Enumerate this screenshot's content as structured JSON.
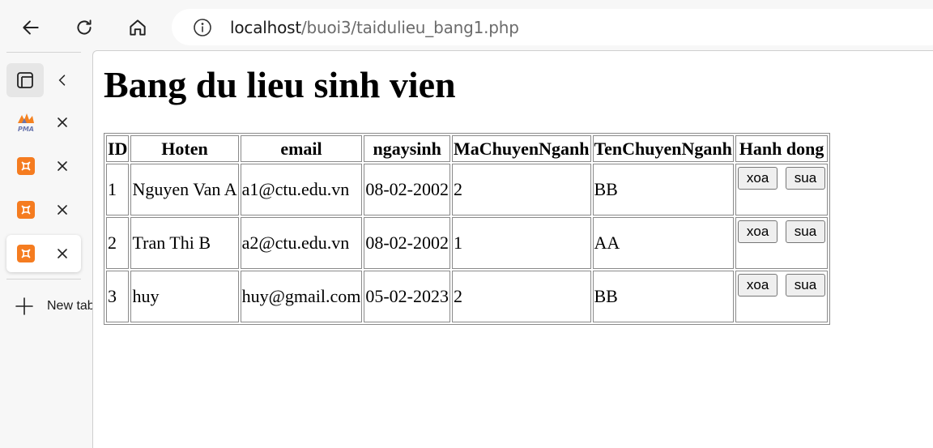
{
  "browser": {
    "url_host": "localhost",
    "url_path": "/buoi3/taidulieu_bang1.php",
    "new_tab_label": "New tab",
    "tabs": [
      {
        "favicon": "pma-icon",
        "favicon_text": "PMA",
        "active": false
      },
      {
        "favicon": "xampp-icon",
        "active": false
      },
      {
        "favicon": "xampp-icon",
        "active": false
      },
      {
        "favicon": "xampp-icon",
        "active": true
      }
    ]
  },
  "page": {
    "title": "Bang du lieu sinh vien",
    "table": {
      "headers": [
        "ID",
        "Hoten",
        "email",
        "ngaysinh",
        "MaChuyenNganh",
        "TenChuyenNganh",
        "Hanh dong"
      ],
      "rows": [
        {
          "id": "1",
          "hoten": "Nguyen Van A",
          "email": "a1@ctu.edu.vn",
          "ngaysinh": "08-02-2002",
          "ma": "2",
          "ten": "BB"
        },
        {
          "id": "2",
          "hoten": "Tran Thi B",
          "email": "a2@ctu.edu.vn",
          "ngaysinh": "08-02-2002",
          "ma": "1",
          "ten": "AA"
        },
        {
          "id": "3",
          "hoten": "huy",
          "email": "huy@gmail.com",
          "ngaysinh": "05-02-2023",
          "ma": "2",
          "ten": "BB"
        }
      ],
      "delete_label": "xoa",
      "edit_label": "sua"
    }
  },
  "colors": {
    "xampp": "#f57c20",
    "pma": "#f58220"
  }
}
